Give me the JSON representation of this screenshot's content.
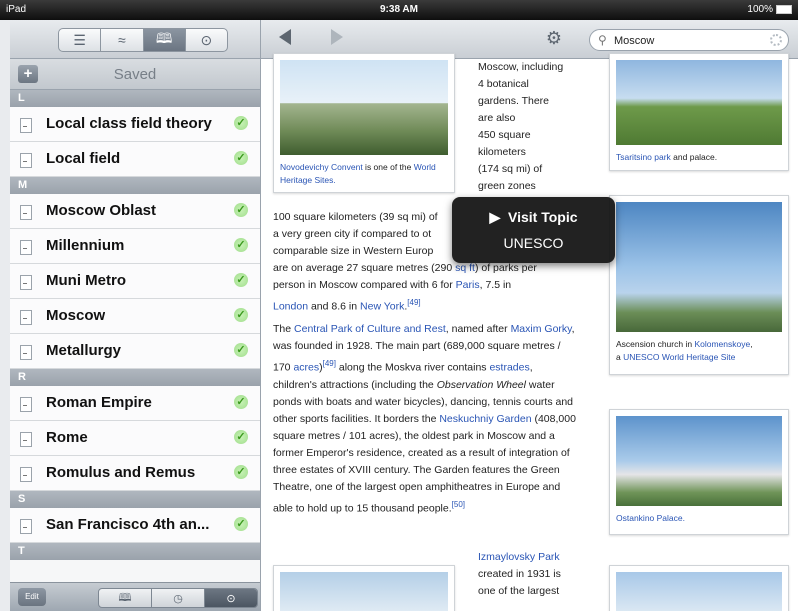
{
  "status": {
    "device": "iPad",
    "time": "9:38 AM",
    "battery": "100%"
  },
  "sidebar": {
    "title": "Saved",
    "add_label": "+",
    "tabs": [
      "list",
      "history-waves",
      "bookmarks",
      "offline"
    ],
    "sections": [
      {
        "letter": "L",
        "items": [
          "Local class field theory",
          "Local field"
        ]
      },
      {
        "letter": "M",
        "items": [
          "Moscow Oblast",
          "Millennium",
          "Muni Metro",
          "Moscow",
          "Metallurgy"
        ]
      },
      {
        "letter": "R",
        "items": [
          "Roman Empire",
          "Rome",
          "Romulus and Remus"
        ]
      },
      {
        "letter": "S",
        "items": [
          "San Francisco 4th an..."
        ]
      },
      {
        "letter": "T",
        "items": []
      }
    ],
    "check_glyph": "✓",
    "edit_label": "Edit"
  },
  "toolbar": {
    "search_value": "Moscow"
  },
  "article": {
    "col_text_top": [
      "Moscow, including",
      "4 botanical",
      "gardens. There",
      "are also",
      "450 square",
      "kilometers",
      "(174 sq mi) of",
      "green zones"
    ],
    "fig_convent": {
      "link": "Novodevichy Convent",
      "text": " is one of the ",
      "link2": "World Heritage Sites."
    },
    "fig_tsar": {
      "link": "Tsaritsino park",
      "text": " and palace."
    },
    "fig_asc": {
      "text": "Ascension church in ",
      "link": "Kolomenskoye",
      "text2": ",",
      "text3": "a ",
      "link2": "UNESCO World Heritage Site"
    },
    "fig_ostank": {
      "link": "Ostankino Palace."
    },
    "p1": {
      "l1a": "100 square kilometers (39 sq mi) of",
      "l2": "a very green city if compared to ot",
      "l3": "comparable size in Western Europ",
      "l4a": "are on average 27 square metres (290 ",
      "l4link": "sq ft",
      "l4b": ") of parks per",
      "l5a": "person in Moscow compared with 6 for ",
      "l5link": "Paris",
      "l5b": ", 7.5 in",
      "l6link": "London",
      "l6a": " and 8.6 in ",
      "l6link2": "New York",
      "l6b": ".",
      "ref1": "[49]"
    },
    "p2": {
      "a": "The ",
      "link1": "Central Park of Culture and Rest",
      "b": ", named after ",
      "link2": "Maxim Gorky",
      "c": ", was founded in 1928. The main part (689,000 square metres / 170 ",
      "link3": "acres",
      "d": ")",
      "ref": "[49]",
      "e": " along the Moskva river contains ",
      "link4": "estrades",
      "f": ", children's attractions (including the ",
      "italic": "Observation Wheel",
      "g": " water ponds with boats and water bicycles), dancing, tennis courts and other sports facilities. It borders the ",
      "link5": "Neskuchniy Garden",
      "h": " (408,000 square metres / 101 acres), the oldest park in Moscow and a former Emperor's residence, created as a result of integration of three estates of XVIII century. The Garden features the Green Theatre, one of the largest open amphitheatres in Europe and able to hold up to 15 thousand people.",
      "ref2": "[50]"
    },
    "p3": {
      "link": "Izmaylovsky Park",
      "l2": "created in 1931 is",
      "l3": "one of the largest"
    }
  },
  "popover": {
    "visit": "Visit Topic",
    "topic": "UNESCO"
  }
}
